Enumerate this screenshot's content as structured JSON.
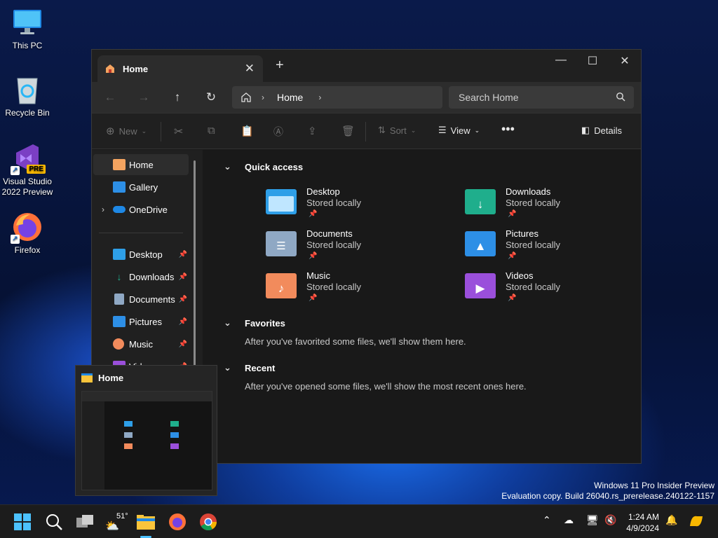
{
  "desktop_icons": [
    {
      "label": "This PC",
      "icon": "monitor-icon"
    },
    {
      "label": "Recycle Bin",
      "icon": "recycle-bin-icon"
    },
    {
      "label": "Visual Studio 2022 Preview",
      "icon": "visual-studio-icon",
      "badge": "PRE"
    },
    {
      "label": "Firefox",
      "icon": "firefox-icon"
    }
  ],
  "window": {
    "tab_title": "Home",
    "navigation": {
      "breadcrumb": "Home",
      "search_placeholder": "Search Home"
    },
    "toolbar": {
      "new_label": "New",
      "sort_label": "Sort",
      "view_label": "View",
      "details_label": "Details"
    },
    "sidebar": {
      "top_items": [
        {
          "label": "Home",
          "icon": "home-icon",
          "selected": true
        },
        {
          "label": "Gallery",
          "icon": "gallery-icon"
        },
        {
          "label": "OneDrive",
          "icon": "onedrive-icon",
          "expandable": true
        }
      ],
      "pinned_items": [
        {
          "label": "Desktop",
          "icon": "desktop-folder-icon"
        },
        {
          "label": "Downloads",
          "icon": "downloads-folder-icon"
        },
        {
          "label": "Documents",
          "icon": "documents-folder-icon"
        },
        {
          "label": "Pictures",
          "icon": "pictures-folder-icon"
        },
        {
          "label": "Music",
          "icon": "music-folder-icon"
        },
        {
          "label": "Vid",
          "icon": "videos-folder-icon"
        }
      ]
    },
    "content": {
      "quick_access": {
        "heading": "Quick access",
        "items": [
          {
            "name": "Desktop",
            "status": "Stored locally",
            "icon": "desktop-folder-icon",
            "color": "#2e9fe8"
          },
          {
            "name": "Downloads",
            "status": "Stored locally",
            "icon": "downloads-folder-icon",
            "color": "#1fae8c"
          },
          {
            "name": "Documents",
            "status": "Stored locally",
            "icon": "documents-folder-icon",
            "color": "#8fa8c4"
          },
          {
            "name": "Pictures",
            "status": "Stored locally",
            "icon": "pictures-folder-icon",
            "color": "#2d8fe6"
          },
          {
            "name": "Music",
            "status": "Stored locally",
            "icon": "music-folder-icon",
            "color": "#f28b5c"
          },
          {
            "name": "Videos",
            "status": "Stored locally",
            "icon": "videos-folder-icon",
            "color": "#9a4fdb"
          }
        ]
      },
      "favorites": {
        "heading": "Favorites",
        "message": "After you've favorited some files, we'll show them here."
      },
      "recent": {
        "heading": "Recent",
        "message": "After you've opened some files, we'll show the most recent ones here."
      }
    }
  },
  "preview": {
    "title": "Home"
  },
  "watermark": {
    "line1": "Windows 11 Pro Insider Preview",
    "line2": "Evaluation copy. Build 26040.rs_prerelease.240122-1157"
  },
  "taskbar": {
    "weather_temp": "51°",
    "time": "1:24 AM",
    "date": "4/9/2024"
  },
  "colors": {
    "accent": "#4cc2ff",
    "window_bg": "#191919",
    "taskbar_bg": "#1c1c1c"
  }
}
